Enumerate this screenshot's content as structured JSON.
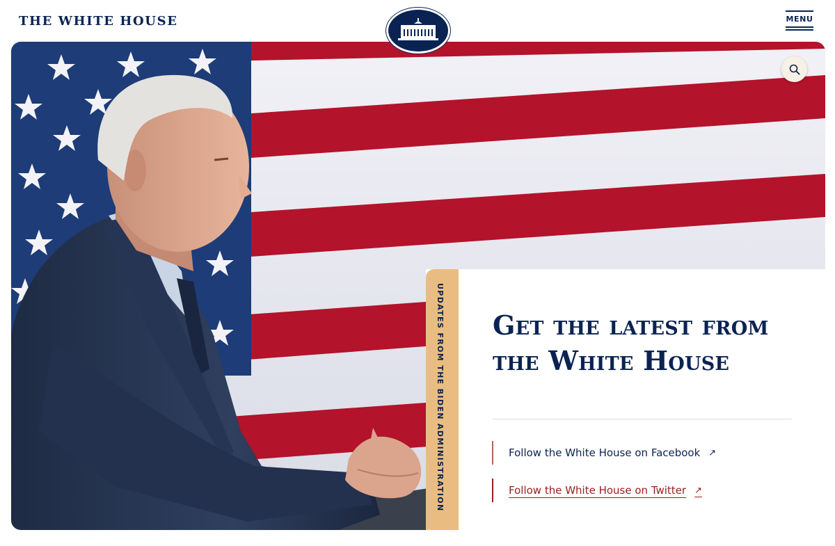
{
  "header": {
    "site_title": "THE WHITE HOUSE",
    "menu_label": "MENU",
    "seal_icon": "white-house-seal-icon"
  },
  "hero": {
    "search_icon": "search-icon",
    "image": "president-at-podium-with-american-flag"
  },
  "card": {
    "tab_text": "UPDATES FROM THE BIDEN ADMINISTRATION",
    "title": "Get the latest from the White House",
    "links": [
      {
        "label": "Follow the White House on Facebook",
        "icon": "external-link-arrow-icon"
      },
      {
        "label": "Follow the White House on Twitter",
        "icon": "external-link-arrow-icon"
      }
    ]
  },
  "colors": {
    "navy": "#0a2352",
    "accent_tab": "#e9bd82",
    "link_red": "#9b1c1c",
    "flag_red": "#b3132b",
    "flag_blue": "#1d3c78"
  }
}
